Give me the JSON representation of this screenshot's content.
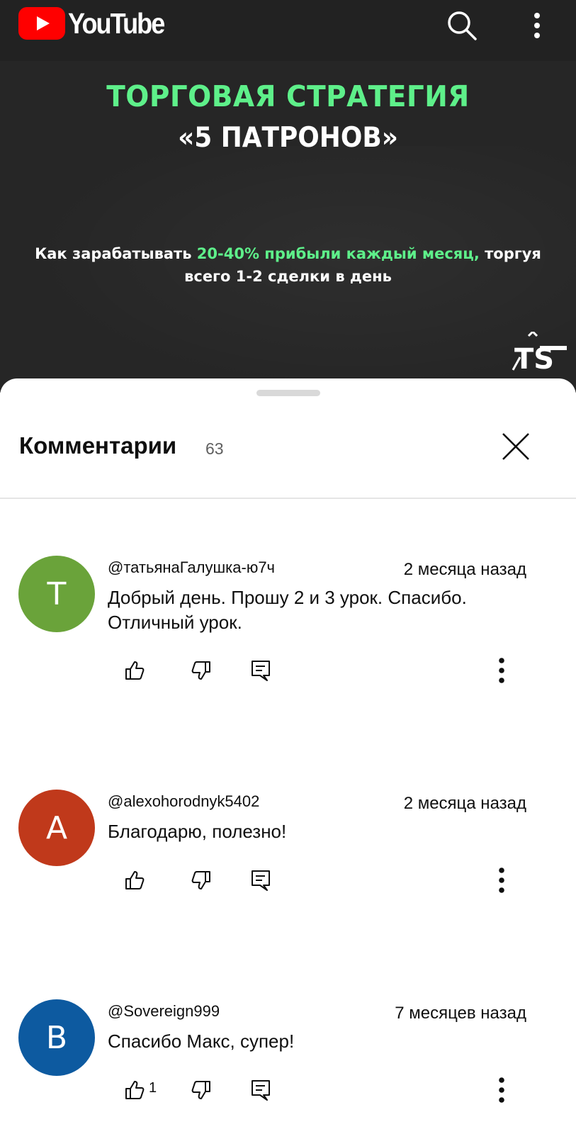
{
  "app": {
    "name": "YouTube",
    "icons": {
      "logo": "youtube-play-icon",
      "search": "search-icon",
      "more": "more-vert-icon"
    },
    "colors": {
      "bar": "#222222",
      "brand_red": "#ff0000"
    }
  },
  "video": {
    "title_line1": "ТОРГОВАЯ СТРАТЕГИЯ",
    "title_line2": "«5 ПАТРОНОВ»",
    "subtitle_prefix": "Как зарабатывать ",
    "subtitle_accent": "20-40% прибыли каждый месяц,",
    "subtitle_suffix": " торгуя",
    "subtitle_line2": "всего 1-2 сделки в день",
    "accent_color": "#5ef08a",
    "channel_logo_icon": "trading-syndicate-logo"
  },
  "comments_panel": {
    "title": "Комментарии",
    "count": "63",
    "close_icon": "close-icon"
  },
  "comments": [
    {
      "avatar_letter": "Т",
      "avatar_color": "#6aa33a",
      "author": "@татьянаГалушка-ю7ч",
      "time": "2 месяца назад",
      "text": "Добрый день. Прошу 2 и 3 урок. Спасибо. Отличный урок.",
      "likes": ""
    },
    {
      "avatar_letter": "A",
      "avatar_color": "#c0391b",
      "author": "@alexohorodnyk5402",
      "time": "2 месяца назад",
      "text": "Благодарю, полезно!",
      "likes": ""
    },
    {
      "avatar_letter": "B",
      "avatar_color": "#0d5aa0",
      "author": "@Sovereign999",
      "time": "7 месяцев назад",
      "text": "Спасибо Макс, супер!",
      "likes": "1"
    }
  ],
  "action_icons": [
    "thumb-up-icon",
    "thumb-down-icon",
    "reply-icon",
    "more-vert-icon"
  ]
}
